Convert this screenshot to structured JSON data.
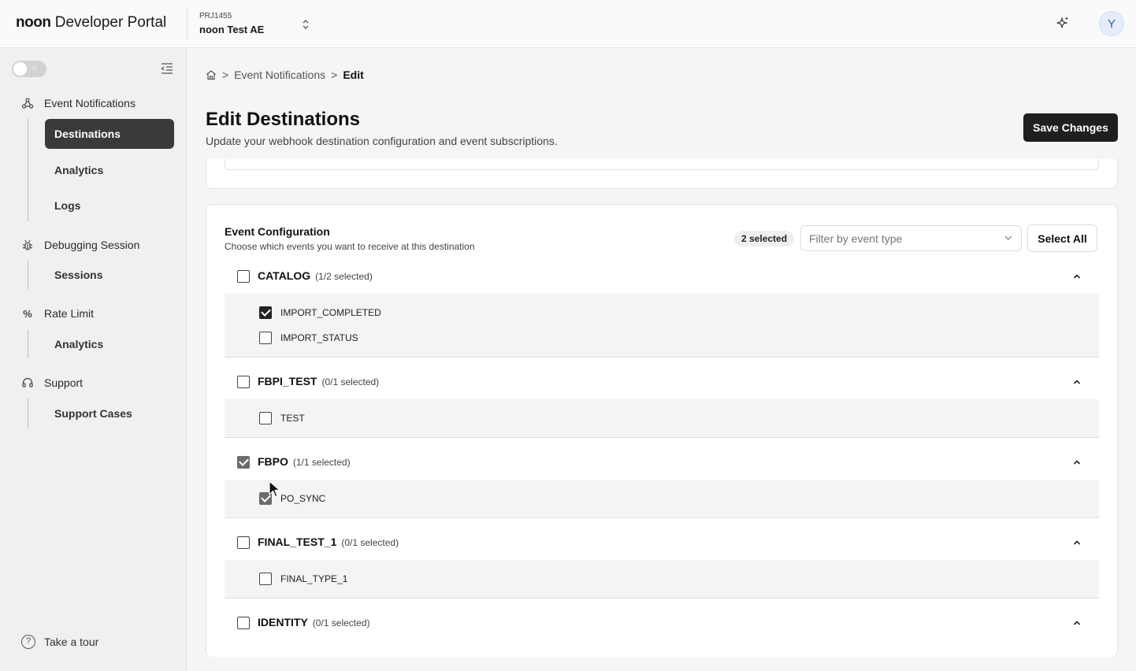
{
  "header": {
    "brand": "noon",
    "portal_name": "Developer Portal",
    "project_id": "PRJ1455",
    "project_name": "noon Test AE",
    "avatar_initial": "Y"
  },
  "sidebar": {
    "sections": [
      {
        "label": "Event Notifications",
        "icon": "webhook-icon",
        "items": [
          "Destinations",
          "Analytics",
          "Logs"
        ]
      },
      {
        "label": "Debugging Session",
        "icon": "bug-icon",
        "items": [
          "Sessions"
        ]
      },
      {
        "label": "Rate Limit",
        "icon": "percent-icon",
        "items": [
          "Analytics"
        ]
      },
      {
        "label": "Support",
        "icon": "headset-icon",
        "items": [
          "Support Cases"
        ]
      }
    ],
    "active_item": "Destinations",
    "tour_label": "Take a tour"
  },
  "breadcrumb": {
    "parent": "Event Notifications",
    "current": "Edit"
  },
  "page": {
    "title": "Edit Destinations",
    "subtitle": "Update your webhook destination configuration and event subscriptions.",
    "save_label": "Save Changes"
  },
  "event_config": {
    "title": "Event Configuration",
    "subtitle": "Choose which events you want to receive at this destination",
    "selected_badge": "2 selected",
    "filter_placeholder": "Filter by event type",
    "select_all_label": "Select All",
    "groups": [
      {
        "name": "CATALOG",
        "count": "(1/2 selected)",
        "checked": false,
        "events": [
          {
            "name": "IMPORT_COMPLETED",
            "checked": true
          },
          {
            "name": "IMPORT_STATUS",
            "checked": false
          }
        ]
      },
      {
        "name": "FBPI_TEST",
        "count": "(0/1 selected)",
        "checked": false,
        "events": [
          {
            "name": "TEST",
            "checked": false
          }
        ]
      },
      {
        "name": "FBPO",
        "count": "(1/1 selected)",
        "checked": true,
        "events": [
          {
            "name": "PO_SYNC",
            "checked": true
          }
        ]
      },
      {
        "name": "FINAL_TEST_1",
        "count": "(0/1 selected)",
        "checked": false,
        "events": [
          {
            "name": "FINAL_TYPE_1",
            "checked": false
          }
        ]
      },
      {
        "name": "IDENTITY",
        "count": "(0/1 selected)",
        "checked": false,
        "events": []
      }
    ]
  }
}
